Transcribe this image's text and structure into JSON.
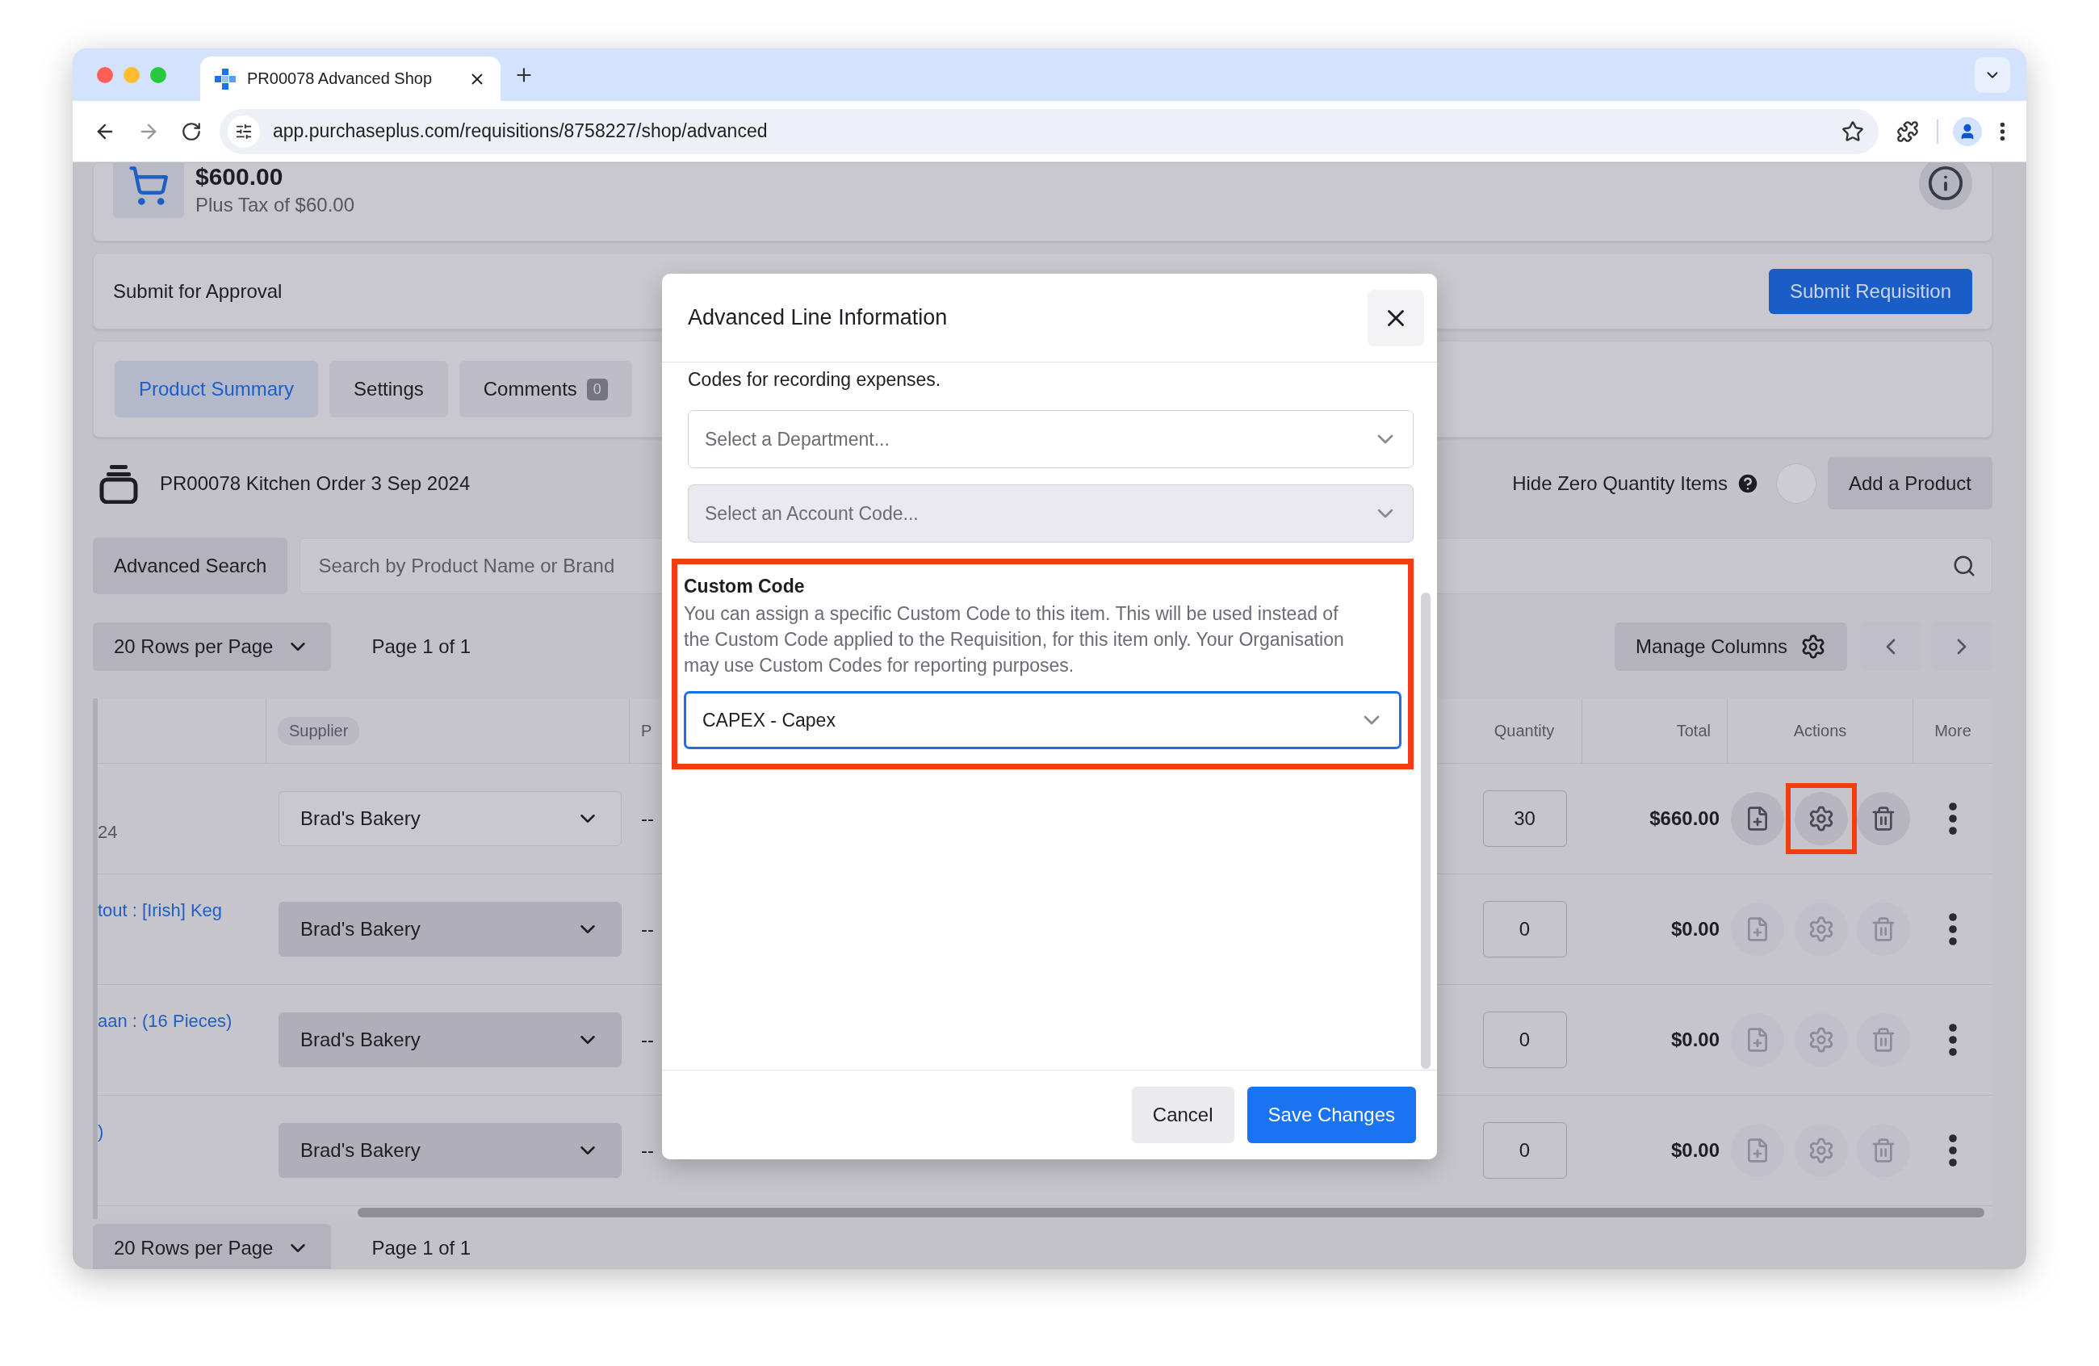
{
  "browser": {
    "tab_title": "PR00078 Advanced Shop",
    "url": "app.purchaseplus.com/requisitions/8758227/shop/advanced"
  },
  "summary": {
    "total": "$600.00",
    "tax": "Plus Tax of $60.00"
  },
  "approval": {
    "label": "Submit for Approval",
    "button": "Submit Requisition"
  },
  "tabs": [
    {
      "label": "Product Summary",
      "selected": true
    },
    {
      "label": "Settings",
      "selected": false
    },
    {
      "label": "Comments",
      "badge": "0",
      "selected": false
    }
  ],
  "order": {
    "title": "PR00078 Kitchen Order 3 Sep 2024",
    "hide_zero_label": "Hide Zero Quantity Items",
    "hide_zero_on": false,
    "add_button": "Add a Product"
  },
  "search": {
    "advanced_button": "Advanced Search",
    "placeholder": "Search by Product Name or Brand"
  },
  "pagination": {
    "rows_per_page": "20 Rows per Page",
    "page": "Page 1 of 1",
    "manage_columns": "Manage Columns"
  },
  "table": {
    "columns": [
      {
        "label": "Supplier",
        "kind": "chip"
      },
      {
        "label": "P",
        "kind": "plain"
      },
      {
        "label": "Quantity",
        "kind": "center"
      },
      {
        "label": "Total",
        "kind": "right"
      },
      {
        "label": "Actions",
        "kind": "center"
      },
      {
        "label": "More",
        "kind": "center"
      }
    ],
    "rows": [
      {
        "product": "24",
        "kind": "text",
        "supplier": "Brad's Bakery",
        "supplier_disabled": false,
        "price": "--",
        "quantity": "30",
        "total": "$660.00",
        "actions_enabled": true,
        "highlighted": true
      },
      {
        "product": "tout : [Irish] Keg",
        "kind": "link",
        "supplier": "Brad's Bakery",
        "supplier_disabled": true,
        "price": "--",
        "quantity": "0",
        "total": "$0.00",
        "actions_enabled": false,
        "highlighted": false
      },
      {
        "product": "aan : (16 Pieces)",
        "kind": "link",
        "supplier": "Brad's Bakery",
        "supplier_disabled": true,
        "price": "--",
        "quantity": "0",
        "total": "$0.00",
        "actions_enabled": false,
        "highlighted": false
      },
      {
        "product": ")",
        "kind": "link",
        "supplier": "Brad's Bakery",
        "supplier_disabled": true,
        "price": "--",
        "quantity": "0",
        "total": "$0.00",
        "actions_enabled": false,
        "highlighted": false
      }
    ]
  },
  "footer_pagination": {
    "rows_per_page": "20 Rows per Page",
    "page": "Page 1 of 1"
  },
  "modal": {
    "title": "Advanced Line Information",
    "intro": "Codes for recording expenses.",
    "selects": [
      {
        "placeholder": "Select a Department...",
        "disabled": false
      },
      {
        "placeholder": "Select an Account Code...",
        "disabled": true
      }
    ],
    "custom_code": {
      "title": "Custom Code",
      "description": "You can assign a specific Custom Code to this item. This will be used instead of the Custom Code applied to the Requisition, for this item only. Your Organisation may use Custom Codes for reporting purposes.",
      "value": "CAPEX - Capex",
      "focused": true,
      "highlighted": true
    },
    "buttons": [
      {
        "label": "Cancel",
        "kind": "secondary"
      },
      {
        "label": "Save Changes",
        "kind": "primary"
      }
    ]
  }
}
